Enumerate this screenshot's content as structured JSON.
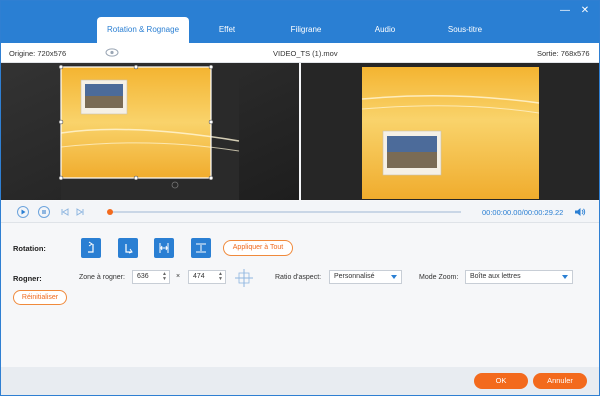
{
  "window": {
    "tabs": [
      {
        "label": "Rotation & Rognage"
      },
      {
        "label": "Effet"
      },
      {
        "label": "Filigrane"
      },
      {
        "label": "Audio"
      },
      {
        "label": "Sous-titre"
      }
    ],
    "minimize": "—",
    "close": "✕"
  },
  "info": {
    "origin": "Origine: 720x576",
    "filename": "VIDEO_TS (1).mov",
    "output": "Sortie: 768x576"
  },
  "playback": {
    "time": "00:00:00.00/00:00:29.22",
    "progress": 0.0
  },
  "rotation": {
    "label": "Rotation:",
    "apply_all": "Appliquer à Tout",
    "icons": [
      "rotate-left-icon",
      "rotate-right-icon",
      "flip-horizontal-icon",
      "flip-vertical-icon"
    ]
  },
  "crop": {
    "label": "Rogner:",
    "zone_label": "Zone à rogner:",
    "width": "636",
    "times": "×",
    "height": "474",
    "aspect_label": "Ratio d'aspect:",
    "aspect_value": "Personnalisé",
    "zoom_label": "Mode Zoom:",
    "zoom_value": "Boîte aux lettres",
    "reset": "Réinitialiser"
  },
  "footer": {
    "ok": "OK",
    "cancel": "Annuler"
  },
  "colors": {
    "accent": "#2a7fd3",
    "orange": "#f36a1d",
    "canvas": "#f7c84a"
  }
}
